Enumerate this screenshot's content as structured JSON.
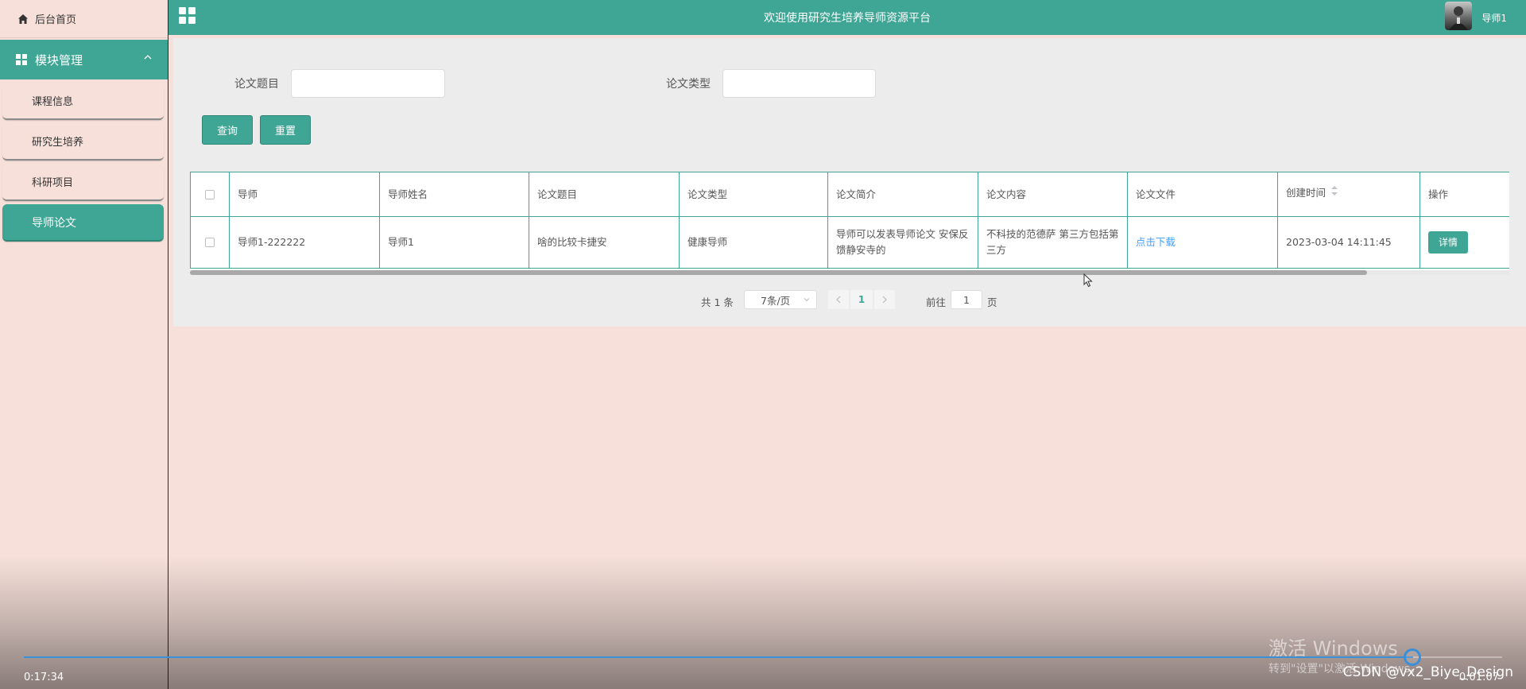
{
  "sidebar": {
    "home_label": "后台首页",
    "module_label": "模块管理",
    "items": [
      {
        "label": "课程信息",
        "active": false
      },
      {
        "label": "研究生培养",
        "active": false
      },
      {
        "label": "科研项目",
        "active": false
      },
      {
        "label": "导师论文",
        "active": true
      }
    ]
  },
  "topbar": {
    "title": "欢迎使用研究生培养导师资源平台",
    "user": "导师1",
    "icons": [
      "apps-icon",
      "avatar"
    ]
  },
  "search": {
    "title_label": "论文题目",
    "title_value": "",
    "type_label": "论文类型",
    "type_value": "",
    "query_button": "查询",
    "reset_button": "重置"
  },
  "table": {
    "headers": [
      "导师",
      "导师姓名",
      "论文题目",
      "论文类型",
      "论文简介",
      "论文内容",
      "论文文件",
      "创建时间",
      "操作"
    ],
    "rows": [
      {
        "cells": [
          "导师1-222222",
          "导师1",
          "啥的比较卡捷安",
          "健康导师",
          "导师可以发表导师论文 安保反馈静安寺的",
          "不科技的范德萨 第三方包括第三方",
          "点击下载",
          "2023-03-04 14:11:45"
        ],
        "action": "详情"
      }
    ]
  },
  "pagination": {
    "total": "共 1 条",
    "page_size": "7条/页",
    "current_page": "1",
    "goto_label": "前往",
    "goto_value": "1",
    "page_suffix": "页"
  },
  "video": {
    "elapsed": "0:17:34",
    "remaining": "0:01:07",
    "progress_fraction": 0.94,
    "watermark_line1": "激活 Windows",
    "watermark_line2": "转到\"设置\"以激活 Windows。",
    "csdn": "CSDN @vx2_Biye_Design"
  },
  "colors": {
    "accent": "#3fa594",
    "background": "#f7e0da",
    "panel": "#ececec",
    "link": "#409eff"
  }
}
